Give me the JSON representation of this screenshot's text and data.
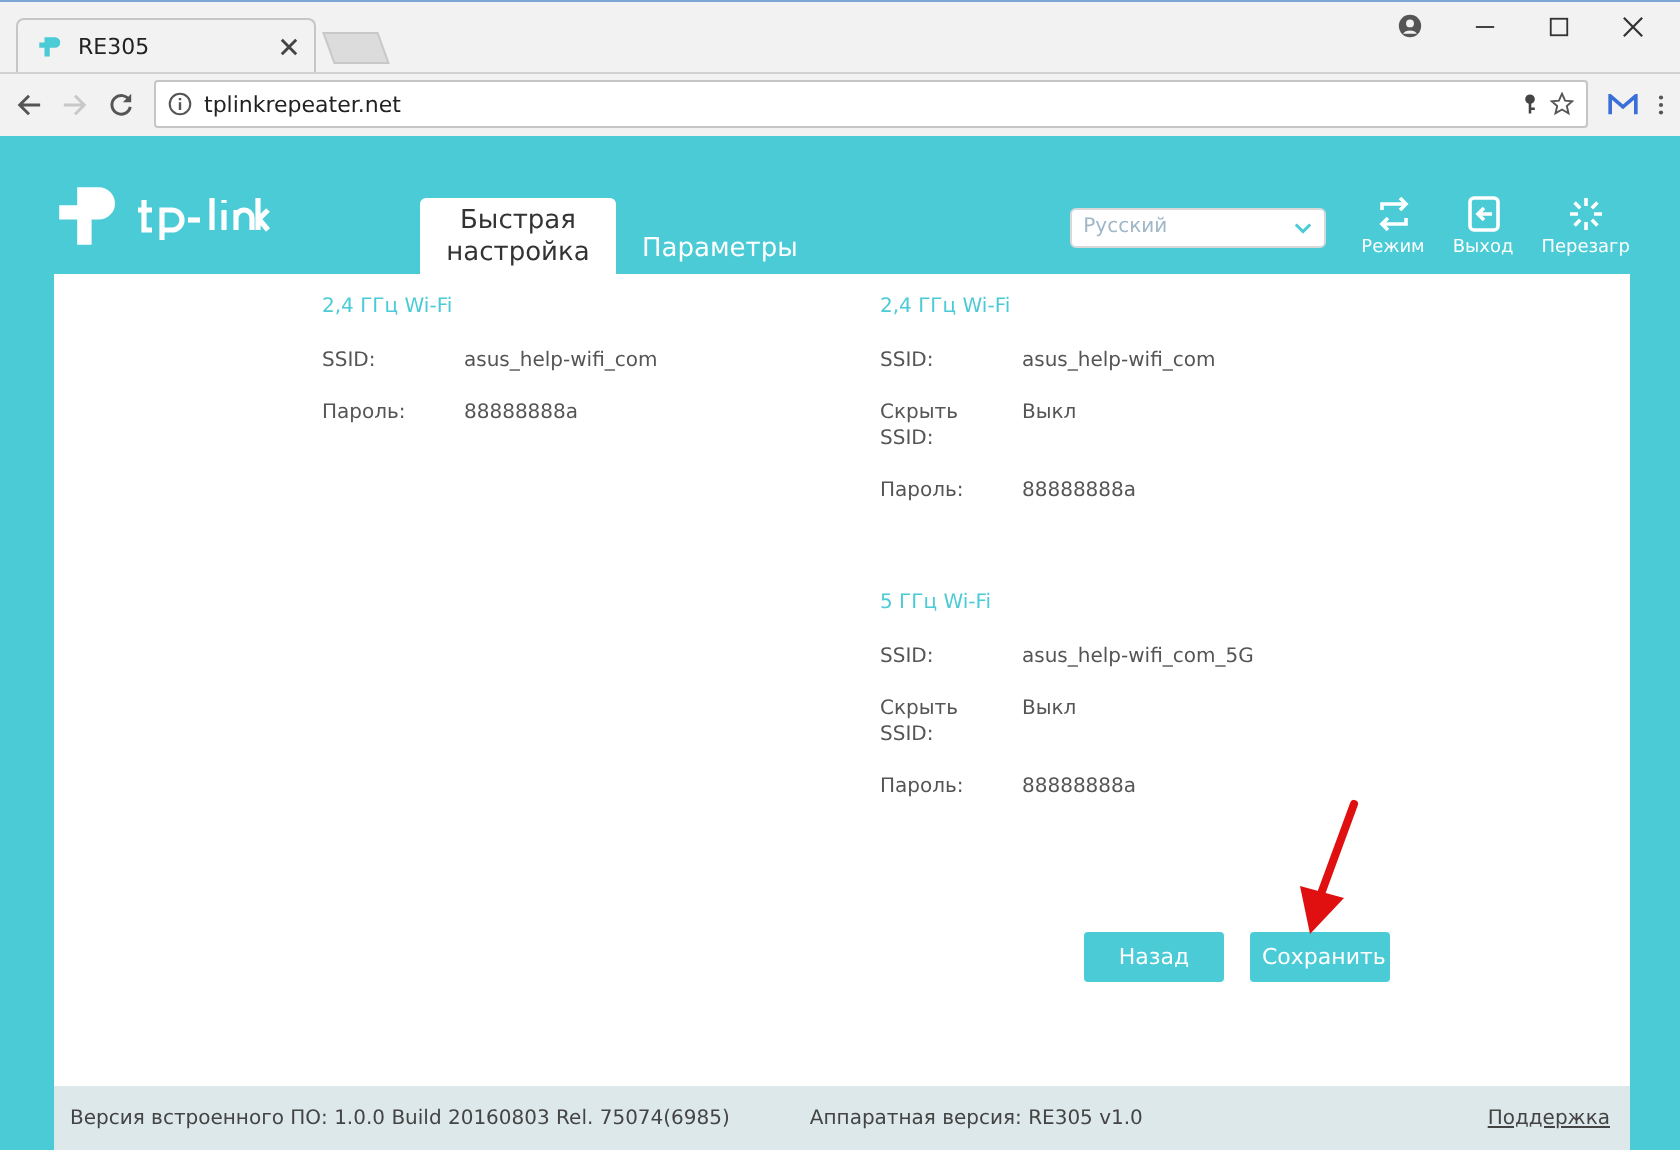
{
  "browser": {
    "tab_title": "RE305",
    "url": "tplinkrepeater.net"
  },
  "header": {
    "tabs": [
      {
        "label": "Быстрая настройка",
        "selected": true
      },
      {
        "label": "Параметры",
        "selected": false
      }
    ],
    "language": "Русский",
    "actions": [
      {
        "kind": "mode",
        "label": "Режим"
      },
      {
        "kind": "logout",
        "label": "Выход"
      },
      {
        "kind": "reboot",
        "label": "Перезагр"
      }
    ]
  },
  "columns": [
    [
      {
        "title": "2,4 ГГц Wi-Fi",
        "rows": [
          {
            "label": "SSID:",
            "value": "asus_help-wifi_com"
          },
          {
            "label": "Пароль:",
            "value": "88888888a"
          }
        ]
      }
    ],
    [
      {
        "title": "2,4 ГГц Wi-Fi",
        "rows": [
          {
            "label": "SSID:",
            "value": "asus_help-wifi_com"
          },
          {
            "label": "Скрыть SSID:",
            "value": "Выкл"
          },
          {
            "label": "Пароль:",
            "value": "88888888a"
          }
        ]
      },
      {
        "title": "5 ГГц Wi-Fi",
        "rows": [
          {
            "label": "SSID:",
            "value": "asus_help-wifi_com_5G"
          },
          {
            "label": "Скрыть SSID:",
            "value": "Выкл"
          },
          {
            "label": "Пароль:",
            "value": "88888888a"
          }
        ]
      }
    ]
  ],
  "buttons": [
    {
      "label": "Назад"
    },
    {
      "label": "Сохранить"
    }
  ],
  "footer": {
    "firmware": "Версия встроенного ПО: 1.0.0 Build 20160803 Rel. 75074(6985)",
    "hardware": "Аппаратная версия: RE305 v1.0",
    "support": "Поддержка"
  }
}
